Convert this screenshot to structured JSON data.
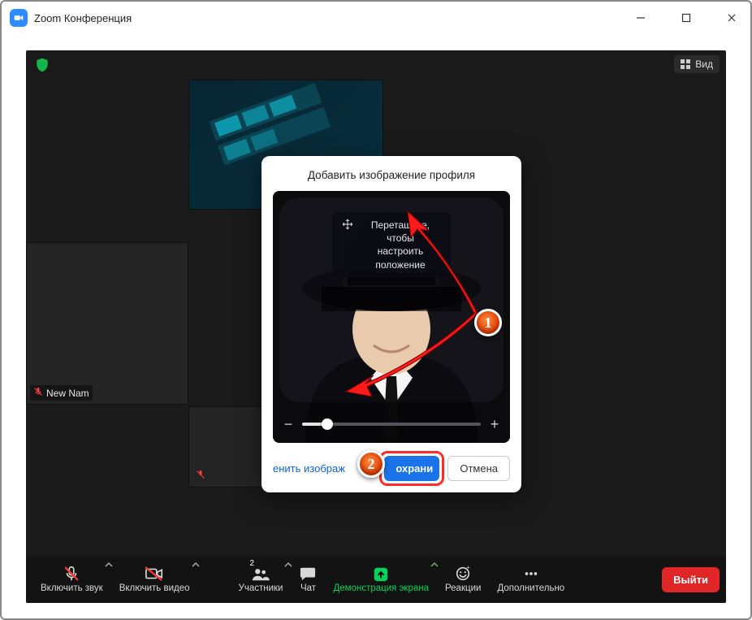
{
  "window": {
    "title": "Zoom Конференция"
  },
  "apptop": {
    "view_label": "Вид"
  },
  "participants": {
    "left_name": "New Nam"
  },
  "modal": {
    "title": "Добавить изображение профиля",
    "drag_tip_line1": "Перетащите, чтобы",
    "drag_tip_line2": "настроить положение",
    "change_link": "енить изображ",
    "save": "охрани",
    "cancel": "Отмена",
    "zoom_minus": "−",
    "zoom_plus": "+"
  },
  "toolbar": {
    "audio": "Включить звук",
    "video": "Включить видео",
    "participants": "Участники",
    "participants_count": "2",
    "chat": "Чат",
    "share": "Демонстрация экрана",
    "reactions": "Реакции",
    "more": "Дополнительно",
    "leave": "Выйти"
  },
  "annotations": {
    "n1": "1",
    "n2": "2"
  }
}
